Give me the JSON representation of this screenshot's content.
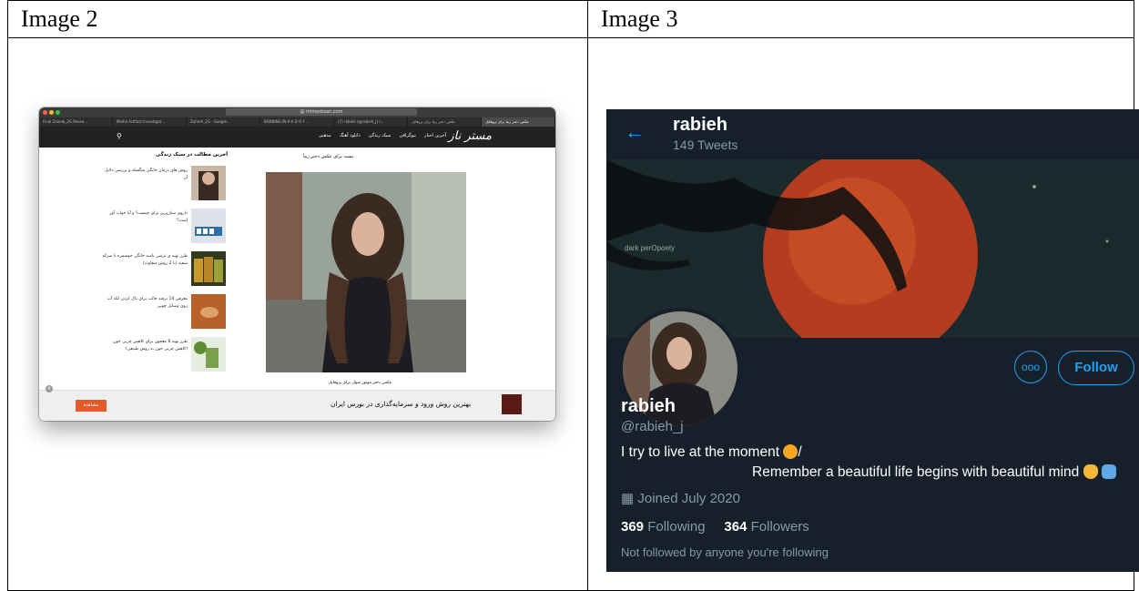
{
  "table": {
    "left_header": "Image 2",
    "right_header": "Image 3"
  },
  "browser": {
    "url": "@ mimestaan.com",
    "tabs": [
      "Final Zainab_2G Resea...",
      "Media Artifact Investigat...",
      "Zohreh_2G - Google...",
      "BANNING IN H A D O F ...",
      "(7) rabieh (@rabieh_j) /...",
      "عکس دختر زیبا برای پروفایل",
      "عکس دختر زیبا برای پروفایل"
    ],
    "nav": [
      "آخرین اخبار",
      "بیوگرافی",
      "سبک زندگی",
      "دانلود آهنگ",
      "مذهبی"
    ],
    "logo": "مستر ناز",
    "sidebar_title": "آخرین مطالب در سبک زندگی",
    "sidebar_items": [
      "روش های درمان خانگی منگسله و بررسی دلایل آن",
      "داروی مینازپرین برای چیست؟ و آیا خواب آور است؟",
      "طرز تهیه ی ترشی نامیه خانگی خوشمزه با سرکه سفید (با 2 روش متفاوت)",
      "معرفی 14 ترفند جالب برای پاک کردن لکه آب روی وسایل چوبی",
      "طرز تهیه 6 معجون برای کاهش چربی خون (کاهش چربی خون به روش طبیعی)"
    ],
    "post_title": "پست برای عکس دختر زیبا",
    "caption": "عکس دختر موتور سوار برای پروفایل",
    "banner_button": "مشاهده",
    "banner_text": "بهترین روش ورود و سرمایه‌گذاری در بورس ایران",
    "close": "x"
  },
  "twitter": {
    "back_icon": "arrow-left-icon",
    "header_name": "rabieh",
    "tweet_count": "149 Tweets",
    "watermark": "dark perOpoety",
    "follow_label": "Follow",
    "more_label": "ooo",
    "profile_name": "rabieh",
    "handle": "@rabieh_j",
    "bio_line1": "I try to live at the moment",
    "bio_line1_suffix": "/",
    "bio_line2": "Remember a beautiful life begins with beautiful mind",
    "joined": "Joined July 2020",
    "following_count": "369",
    "following_label": "Following",
    "followers_count": "364",
    "followers_label": "Followers",
    "not_followed": "Not followed by anyone you're following",
    "accent": "#1da1f2",
    "background": "#15202b"
  }
}
